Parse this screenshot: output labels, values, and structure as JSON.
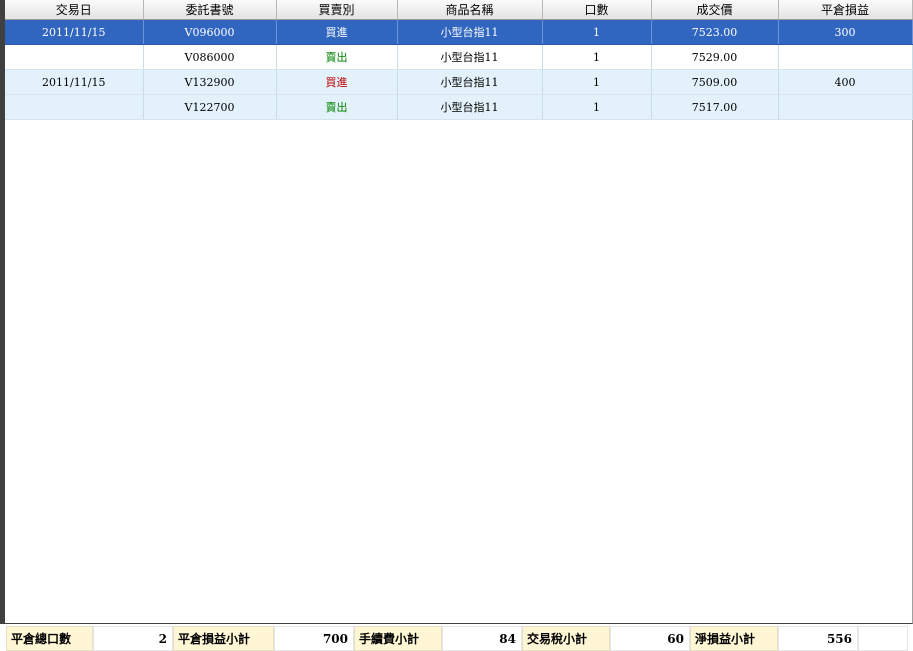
{
  "grid": {
    "columns": [
      "交易日",
      "委託書號",
      "買賣別",
      "商品名稱",
      "口數",
      "成交價",
      "平倉損益"
    ],
    "rows": [
      {
        "date": "2011/11/15",
        "order_no": "V096000",
        "side": "買進",
        "side_type": "buy",
        "product": "小型台指11",
        "qty": "1",
        "price": "7523.00",
        "pnl": "300"
      },
      {
        "date": "",
        "order_no": "V086000",
        "side": "賣出",
        "side_type": "sell",
        "product": "小型台指11",
        "qty": "1",
        "price": "7529.00",
        "pnl": ""
      },
      {
        "date": "2011/11/15",
        "order_no": "V132900",
        "side": "買進",
        "side_type": "buy",
        "product": "小型台指11",
        "qty": "1",
        "price": "7509.00",
        "pnl": "400"
      },
      {
        "date": "",
        "order_no": "V122700",
        "side": "賣出",
        "side_type": "sell",
        "product": "小型台指11",
        "qty": "1",
        "price": "7517.00",
        "pnl": ""
      }
    ]
  },
  "summary": {
    "close_total_qty_label": "平倉總口數",
    "close_total_qty": "2",
    "close_pnl_subtotal_label": "平倉損益小計",
    "close_pnl_subtotal": "700",
    "fee_subtotal_label": "手續費小計",
    "fee_subtotal": "84",
    "tax_subtotal_label": "交易稅小計",
    "tax_subtotal": "60",
    "net_pnl_subtotal_label": "淨損益小計",
    "net_pnl_subtotal": "556"
  },
  "colors": {
    "selected_row": "#3166c0",
    "tint_row": "#e3f2fa",
    "buy": "#c00000",
    "sell": "#008000",
    "summary_label_bg": "#fff6d6"
  }
}
